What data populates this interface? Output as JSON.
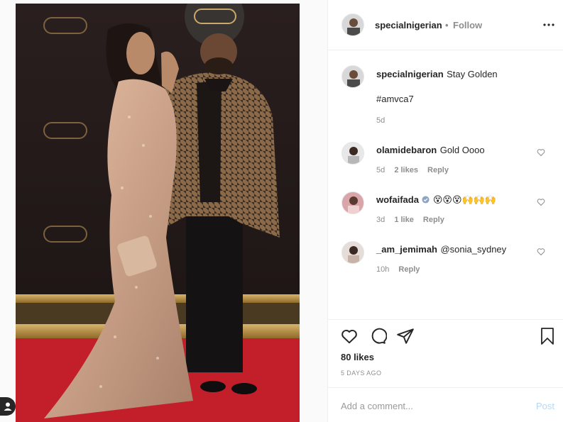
{
  "post": {
    "author": "specialnigerian",
    "follow_separator": "•",
    "follow_label": "Follow",
    "more_icon": "more-horizontal-icon"
  },
  "caption": {
    "username": "specialnigerian",
    "text": "Stay Golden",
    "hashtag": "#amvca7",
    "time": "5d"
  },
  "comments": [
    {
      "username": "olamidebaron",
      "text": "Gold Oooo",
      "time": "5d",
      "likes": "2 likes",
      "reply": "Reply"
    },
    {
      "username": "wofaifada",
      "verified_icon": "verified-badge-icon",
      "text": "😵😵😵🙌🙌🙌",
      "time": "3d",
      "likes": "1 like",
      "reply": "Reply"
    },
    {
      "username": "_am_jemimah",
      "text": "@sonia_sydney",
      "time": "10h",
      "reply": "Reply"
    }
  ],
  "actions": {
    "like_icon": "heart-icon",
    "comment_icon": "comment-icon",
    "share_icon": "send-icon",
    "save_icon": "bookmark-icon"
  },
  "likes_count": "80 likes",
  "posted_date": "5 DAYS AGO",
  "composer": {
    "placeholder": "Add a comment...",
    "post_label": "Post"
  },
  "colors": {
    "border": "#efefef",
    "muted": "#8e8e8e",
    "text": "#262626",
    "post_disabled": "#b8d7f4",
    "carpet": "#c21f2b"
  }
}
